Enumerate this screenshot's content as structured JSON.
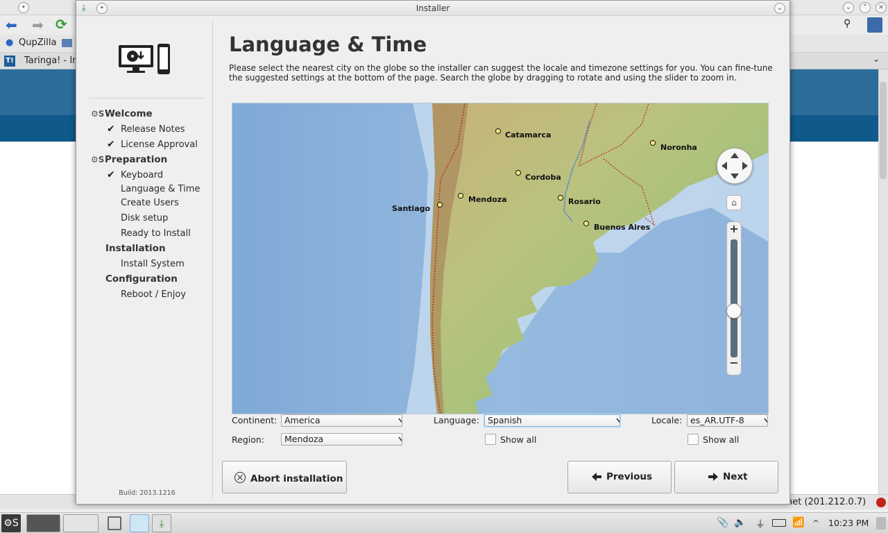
{
  "browser": {
    "app_name": "QupZilla",
    "tab_title": "Taringa! - In",
    "status_text": "net (201.212.0.7)"
  },
  "installer": {
    "window_title": "Installer",
    "build": "Build: 2013.1216",
    "sidebar": [
      {
        "label": "Welcome",
        "type": "section"
      },
      {
        "label": "Release Notes",
        "type": "done"
      },
      {
        "label": "License Approval",
        "type": "done"
      },
      {
        "label": "Preparation",
        "type": "section"
      },
      {
        "label": "Keyboard",
        "type": "done"
      },
      {
        "label": "Language & Time",
        "type": "current"
      },
      {
        "label": "Create Users",
        "type": "pending"
      },
      {
        "label": "Disk setup",
        "type": "pending"
      },
      {
        "label": "Ready to Install",
        "type": "pending"
      },
      {
        "label": "Installation",
        "type": "section"
      },
      {
        "label": "Install System",
        "type": "pending"
      },
      {
        "label": "Configuration",
        "type": "section"
      },
      {
        "label": "Reboot / Enjoy",
        "type": "pending"
      }
    ],
    "page": {
      "title": "Language & Time",
      "description": "Please select the nearest city on the globe so the installer can suggest the locale and timezone settings for you. You can fine-tune the suggested settings at the bottom of the page. Search the globe by dragging to rotate and using the slider to zoom in."
    },
    "map": {
      "cities": [
        "Catamarca",
        "Noronha",
        "Cordoba",
        "Mendoza",
        "Rosario",
        "Santiago",
        "Buenos Aires"
      ],
      "zoom_in": "+",
      "zoom_out": "−"
    },
    "settings": {
      "continent_label": "Continent:",
      "continent_value": "America",
      "region_label": "Region:",
      "region_value": "Mendoza",
      "language_label": "Language:",
      "language_value": "Spanish",
      "locale_label": "Locale:",
      "locale_value": "es_AR.UTF-8",
      "show_all_language": "Show all",
      "show_all_locale": "Show all"
    },
    "buttons": {
      "abort": "Abort installation",
      "previous": "Previous",
      "next": "Next"
    }
  },
  "taskbar": {
    "clock": "10:23 PM"
  }
}
